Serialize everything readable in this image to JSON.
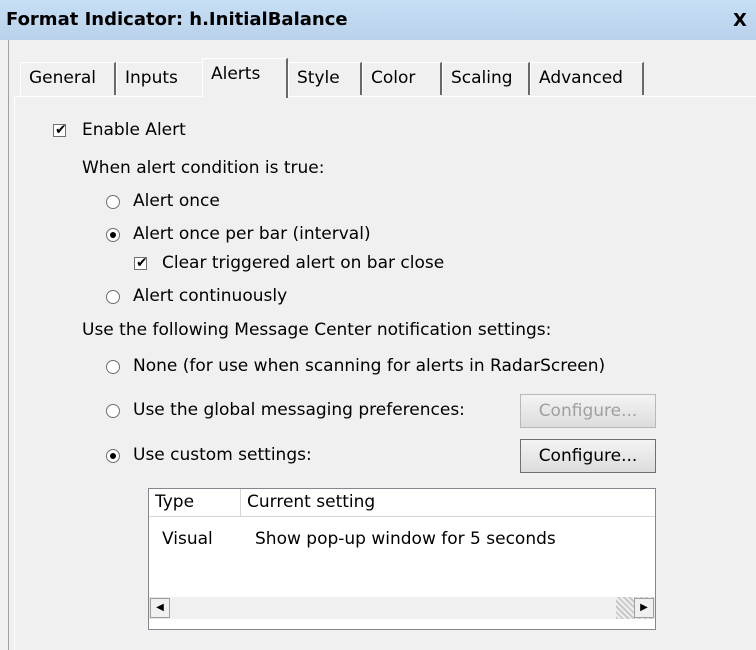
{
  "window": {
    "title": "Format Indicator: h.InitialBalance",
    "close_glyph": "X"
  },
  "tabs": [
    {
      "label": "General",
      "active": false
    },
    {
      "label": "Inputs",
      "active": false
    },
    {
      "label": "Alerts",
      "active": true
    },
    {
      "label": "Style",
      "active": false
    },
    {
      "label": "Color",
      "active": false
    },
    {
      "label": "Scaling",
      "active": false
    },
    {
      "label": "Advanced",
      "active": false
    }
  ],
  "alerts": {
    "enable_alert": {
      "label": "Enable Alert",
      "checked": true
    },
    "condition_heading": "When alert condition is true:",
    "frequency": {
      "options": [
        {
          "label": "Alert once",
          "selected": false
        },
        {
          "label": "Alert once per bar (interval)",
          "selected": true
        },
        {
          "label": "Alert continuously",
          "selected": false
        }
      ],
      "clear_on_bar_close": {
        "label": "Clear triggered alert on bar close",
        "checked": true
      }
    },
    "notification_heading": "Use the following Message Center notification settings:",
    "notification": {
      "options": [
        {
          "label": "None (for use when scanning for alerts in RadarScreen)",
          "selected": false
        },
        {
          "label": "Use the global messaging preferences:",
          "selected": false
        },
        {
          "label": "Use custom settings:",
          "selected": true
        }
      ],
      "configure_global_label": "Configure...",
      "configure_custom_label": "Configure..."
    },
    "settings_table": {
      "columns": [
        "Type",
        "Current setting"
      ],
      "rows": [
        {
          "type": "Visual",
          "setting": "Show pop-up window for 5 seconds"
        }
      ]
    }
  },
  "icons": {
    "check": "✔",
    "scroll_left": "◀",
    "scroll_right": "▶"
  }
}
